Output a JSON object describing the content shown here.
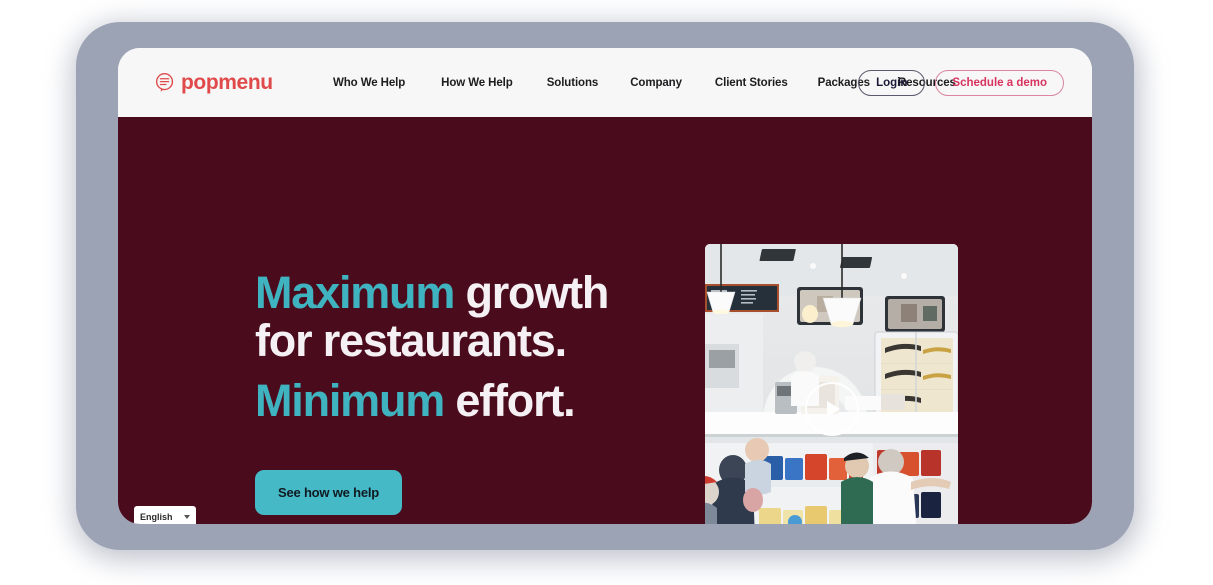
{
  "brand": {
    "name": "popmenu",
    "icon": "speech-bubble-menu-icon",
    "color": "#e04a4a"
  },
  "nav": {
    "links": [
      {
        "label": "Who We Help"
      },
      {
        "label": "How We Help"
      },
      {
        "label": "Solutions"
      },
      {
        "label": "Company"
      },
      {
        "label": "Client Stories"
      },
      {
        "label": "Packages"
      },
      {
        "label": "Resources"
      }
    ],
    "login_label": "Login",
    "demo_label": "Schedule a demo"
  },
  "hero": {
    "headline": {
      "line1_accent": "Maximum",
      "line1_rest": " growth",
      "line2": "for restaurants.",
      "line3_accent": "Minimum",
      "line3_rest": " effort."
    },
    "cta_label": "See how we help",
    "background_color": "#4a0c1d",
    "accent_color": "#3fb3bf",
    "cta_color": "#45bac6"
  },
  "video": {
    "name": "restaurant-deli-counter-video",
    "play_icon": "play-icon",
    "description": "Customers ordering at a deli counter with pendant lights and snack racks"
  },
  "language_selector": {
    "value": "English",
    "caret_icon": "chevron-down-icon"
  },
  "frame": {
    "frame_color": "#9ca3b5",
    "chrome_color": "#f7f7f7"
  }
}
